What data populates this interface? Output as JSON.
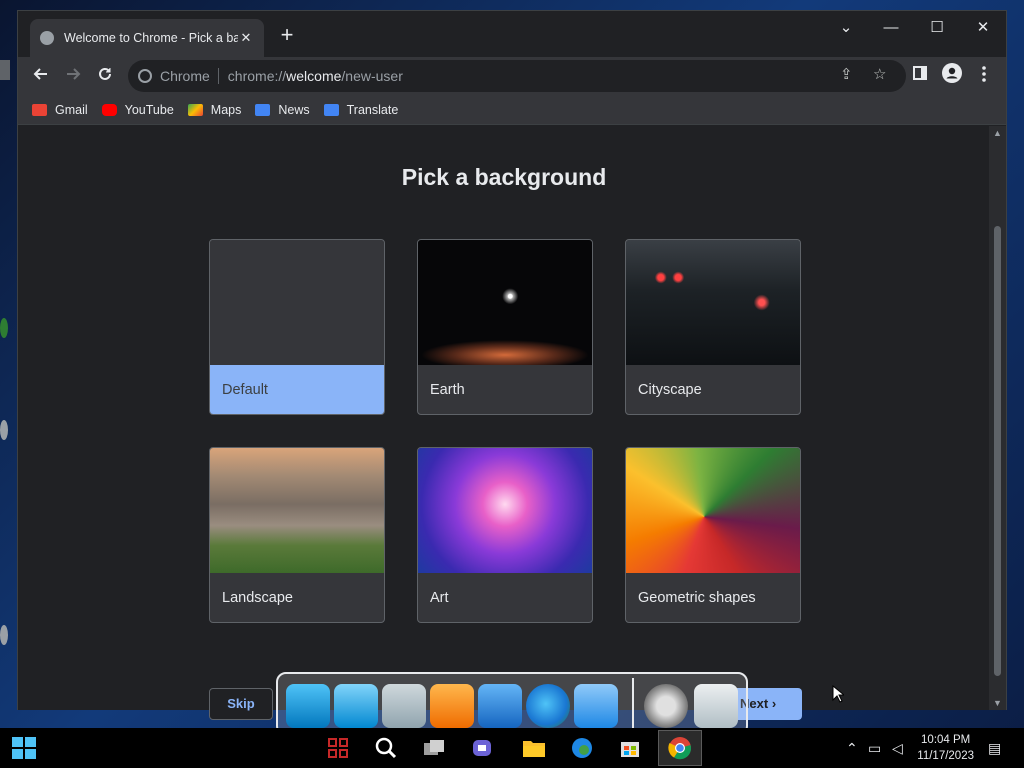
{
  "browser": {
    "tab_title": "Welcome to Chrome - Pick a background",
    "window_controls": {
      "menu": "⌄",
      "minimize": "—",
      "maximize": "☐",
      "close": "✕"
    },
    "omnibox": {
      "site_chip": "Chrome",
      "scheme": "chrome://",
      "host": "welcome",
      "path": "/new-user"
    },
    "bookmarks": [
      {
        "label": "Gmail",
        "color": "#ea4335"
      },
      {
        "label": "YouTube",
        "color": "#ff0000"
      },
      {
        "label": "Maps",
        "color": "#34a853"
      },
      {
        "label": "News",
        "color": "#4285f4"
      },
      {
        "label": "Translate",
        "color": "#4285f4"
      }
    ]
  },
  "page": {
    "heading": "Pick a background",
    "backgrounds": [
      {
        "label": "Default",
        "selected": true
      },
      {
        "label": "Earth",
        "selected": false
      },
      {
        "label": "Cityscape",
        "selected": false
      },
      {
        "label": "Landscape",
        "selected": false
      },
      {
        "label": "Art",
        "selected": false
      },
      {
        "label": "Geometric shapes",
        "selected": false
      }
    ],
    "skip_label": "Skip",
    "next_label": "Next"
  },
  "dock": {
    "items": [
      "monitor-icon",
      "network-icon",
      "file-manager-icon",
      "music-folder-icon",
      "pictures-folder-icon",
      "edge-icon",
      "presentation-icon",
      "settings-icon",
      "recycle-bin-icon"
    ]
  },
  "taskbar": {
    "time": "10:04 PM",
    "date": "11/17/2023"
  },
  "colors": {
    "accent": "#8ab4f8",
    "page_bg": "#202124",
    "toolbar_bg": "#35363a"
  }
}
